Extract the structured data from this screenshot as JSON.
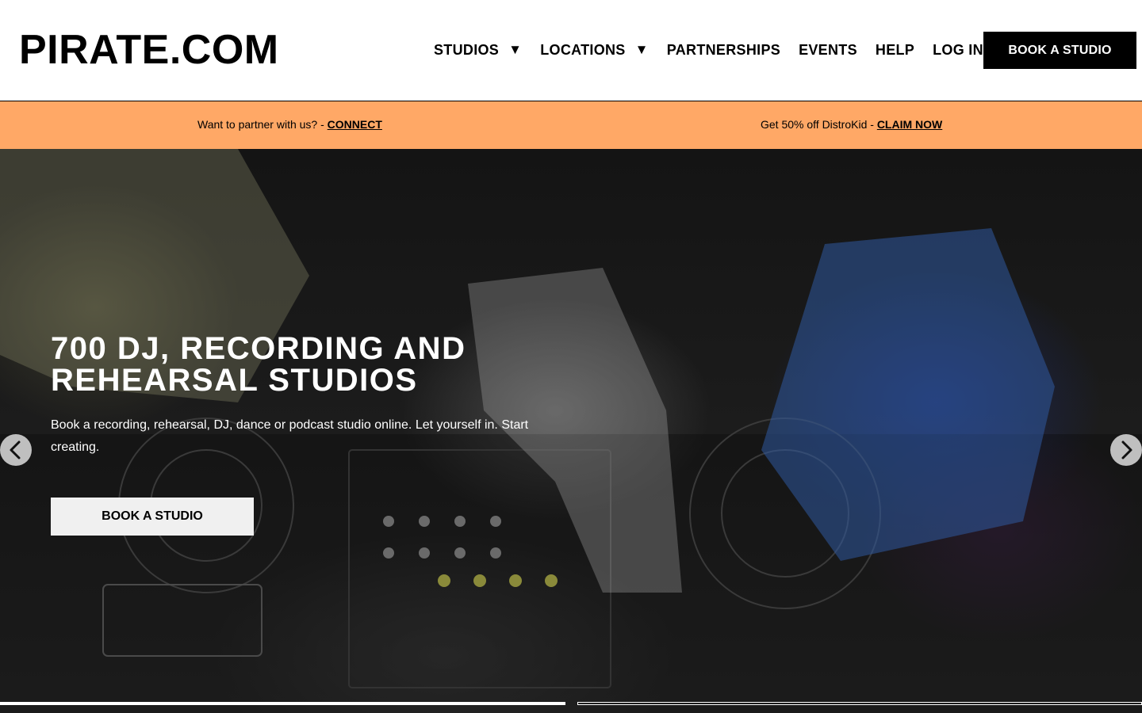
{
  "header": {
    "logo": "PIRATE.COM",
    "nav": [
      {
        "label": "STUDIOS",
        "has_dropdown": true
      },
      {
        "label": "LOCATIONS",
        "has_dropdown": true
      },
      {
        "label": "PARTNERSHIPS",
        "has_dropdown": false
      },
      {
        "label": "EVENTS",
        "has_dropdown": false
      },
      {
        "label": "HELP",
        "has_dropdown": false
      },
      {
        "label": "LOG IN",
        "has_dropdown": false
      }
    ],
    "caret": "▼",
    "cta_label": "BOOK A STUDIO"
  },
  "promo": {
    "left_text": "Want to partner with us? - ",
    "left_link": "CONNECT",
    "right_text": "Get 50% off DistroKid - ",
    "right_link": "CLAIM NOW",
    "background": "#ffa866"
  },
  "hero": {
    "title": "700 DJ, RECORDING AND REHEARSAL STUDIOS",
    "subtitle": "Book a recording, rehearsal, DJ, dance or podcast studio online. Let yourself in. Start creating.",
    "cta_label": "BOOK A STUDIO",
    "prev_icon": "chevron-left-icon",
    "next_icon": "chevron-right-icon",
    "slides_total": 2,
    "active_slide": 1
  },
  "colors": {
    "header_bg": "#ffffff",
    "primary_button": "#000000",
    "hero_button": "#f0f0f0"
  }
}
